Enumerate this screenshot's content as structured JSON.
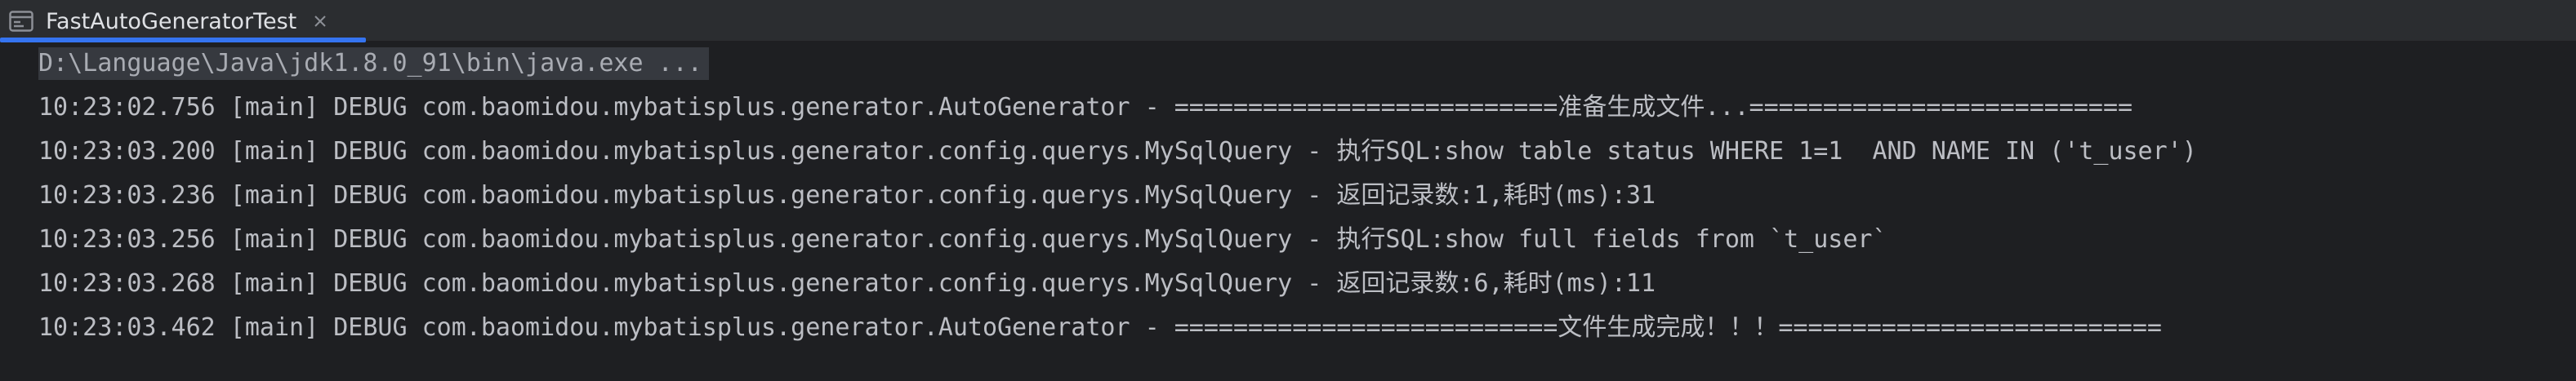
{
  "tab": {
    "icon": "console-icon",
    "title": "FastAutoGeneratorTest",
    "close_icon": "close-icon"
  },
  "console": {
    "lines": [
      "D:\\Language\\Java\\jdk1.8.0_91\\bin\\java.exe ...",
      "10:23:02.756 [main] DEBUG com.baomidou.mybatisplus.generator.AutoGenerator - ==========================准备生成文件...==========================",
      "10:23:03.200 [main] DEBUG com.baomidou.mybatisplus.generator.config.querys.MySqlQuery - 执行SQL:show table status WHERE 1=1  AND NAME IN ('t_user')",
      "10:23:03.236 [main] DEBUG com.baomidou.mybatisplus.generator.config.querys.MySqlQuery - 返回记录数:1,耗时(ms):31",
      "10:23:03.256 [main] DEBUG com.baomidou.mybatisplus.generator.config.querys.MySqlQuery - 执行SQL:show full fields from `t_user`",
      "10:23:03.268 [main] DEBUG com.baomidou.mybatisplus.generator.config.querys.MySqlQuery - 返回记录数:6,耗时(ms):11",
      "10:23:03.462 [main] DEBUG com.baomidou.mybatisplus.generator.AutoGenerator - ==========================文件生成完成！！！=========================="
    ]
  },
  "colors": {
    "accent": "#3574f0",
    "background": "#1e1f22",
    "text": "#bcbec4"
  }
}
